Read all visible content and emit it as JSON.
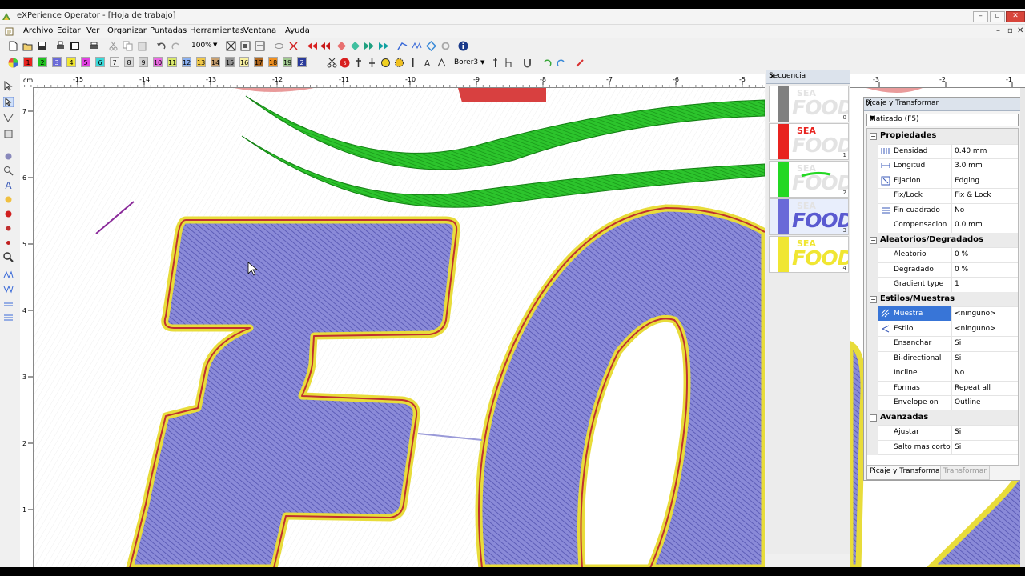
{
  "window": {
    "title": "eXPerience Operator - [Hoja de trabajo]"
  },
  "menu": [
    "Archivo",
    "Editar",
    "Ver",
    "Organizar",
    "Puntadas",
    "Herramientas",
    "Ventana",
    "Ayuda"
  ],
  "toolbar": {
    "zoom": "100%",
    "font": "Borer3"
  },
  "colors": [
    {
      "n": "1",
      "c": "#e8231f"
    },
    {
      "n": "2",
      "c": "#23c223"
    },
    {
      "n": "3",
      "c": "#6a6ad8"
    },
    {
      "n": "4",
      "c": "#f0e632"
    },
    {
      "n": "5",
      "c": "#e040e0"
    },
    {
      "n": "6",
      "c": "#3ad8d8"
    },
    {
      "n": "7",
      "c": "#f0f0f0"
    },
    {
      "n": "8",
      "c": "#d8d8d8"
    },
    {
      "n": "9",
      "c": "#d0d0d0"
    },
    {
      "n": "10",
      "c": "#e86ae0"
    },
    {
      "n": "11",
      "c": "#d8e86a"
    },
    {
      "n": "12",
      "c": "#8ab0f0"
    },
    {
      "n": "13",
      "c": "#f0c84a"
    },
    {
      "n": "14",
      "c": "#c8a070"
    },
    {
      "n": "15",
      "c": "#909090"
    },
    {
      "n": "16",
      "c": "#f8f0a0"
    },
    {
      "n": "17",
      "c": "#b06820"
    },
    {
      "n": "18",
      "c": "#f09020"
    },
    {
      "n": "19",
      "c": "#a0c890"
    },
    {
      "n": "2",
      "c": "#2a3a9a"
    }
  ],
  "ruler": {
    "unit": "cm",
    "h_labels": [
      "-15",
      "-14",
      "-13",
      "-12",
      "-11",
      "-10",
      "-9",
      "-8",
      "-7",
      "-6",
      "-5"
    ],
    "h_labels_right": [
      "-3",
      "-2",
      "-1"
    ],
    "v_labels": [
      "7",
      "6",
      "5",
      "4",
      "3",
      "2",
      "1"
    ]
  },
  "sequence": {
    "title": "Secuencia",
    "items": [
      {
        "num": "0",
        "color": "#808080"
      },
      {
        "num": "1",
        "color": "#e8231f"
      },
      {
        "num": "2",
        "color": "#23d823"
      },
      {
        "num": "3",
        "color": "#6a6ad8"
      },
      {
        "num": "4",
        "color": "#f0e632"
      }
    ],
    "sea": "SEA",
    "food": "FOOD"
  },
  "props": {
    "title": "Picaje y Transformar",
    "combo": "Matizado (F5)",
    "rows": [
      {
        "type": "cat",
        "k": "Propiedades"
      },
      {
        "k": "Densidad",
        "v": "0.40 mm",
        "icon": "density-icon"
      },
      {
        "k": "Longitud",
        "v": "3.0 mm",
        "icon": "length-icon"
      },
      {
        "k": "Fijacion",
        "v": "Edging",
        "icon": "fixation-icon"
      },
      {
        "k": "Fix/Lock",
        "v": "Fix & Lock"
      },
      {
        "k": "Fin cuadrado",
        "v": "No",
        "icon": "square-end-icon"
      },
      {
        "k": "Compensacion",
        "v": "0.0 mm"
      },
      {
        "type": "cat",
        "k": "Aleatorios/Degradados"
      },
      {
        "k": "Aleatorio",
        "v": "0 %"
      },
      {
        "k": "Degradado",
        "v": "0 %"
      },
      {
        "k": "Gradient type",
        "v": "1"
      },
      {
        "type": "cat",
        "k": "Estilos/Muestras"
      },
      {
        "k": "Muestra",
        "v": "<ninguno>",
        "sel": true,
        "icon": "pattern-icon"
      },
      {
        "k": "Estilo",
        "v": "<ninguno>",
        "icon": "style-icon"
      },
      {
        "k": "Ensanchar",
        "v": "Si"
      },
      {
        "k": "Bi-directional",
        "v": "Si"
      },
      {
        "k": "Incline",
        "v": "No"
      },
      {
        "k": "Formas",
        "v": "Repeat all"
      },
      {
        "k": "Envelope on",
        "v": "Outline"
      },
      {
        "type": "cat",
        "k": "Avanzadas"
      },
      {
        "k": "Ajustar",
        "v": "Si"
      },
      {
        "k": "Salto mas corto",
        "v": "Si"
      }
    ],
    "tabs": [
      "Picaje y Transformar",
      "Transformar"
    ]
  }
}
